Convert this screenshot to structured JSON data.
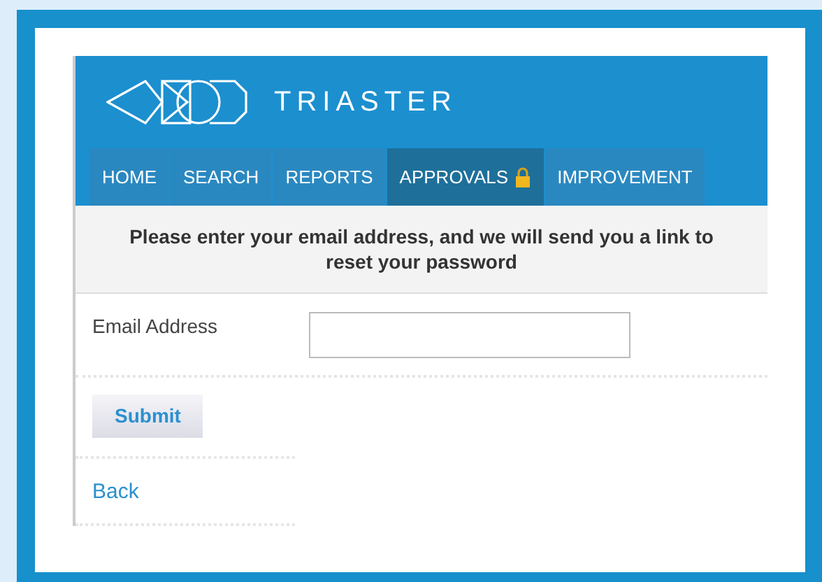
{
  "brand": {
    "name": "TRIASTER"
  },
  "nav": [
    {
      "label": "HOME",
      "selected": false,
      "locked": false
    },
    {
      "label": "SEARCH",
      "selected": false,
      "locked": false
    },
    {
      "label": "REPORTS",
      "selected": false,
      "locked": false
    },
    {
      "label": "APPROVALS",
      "selected": true,
      "locked": true
    },
    {
      "label": "IMPROVEMENT",
      "selected": false,
      "locked": false
    }
  ],
  "message": "Please enter your email address, and we will send you a link to reset your password",
  "form": {
    "label": "Email Address"
  },
  "submit": "Submit",
  "back": "Back"
}
